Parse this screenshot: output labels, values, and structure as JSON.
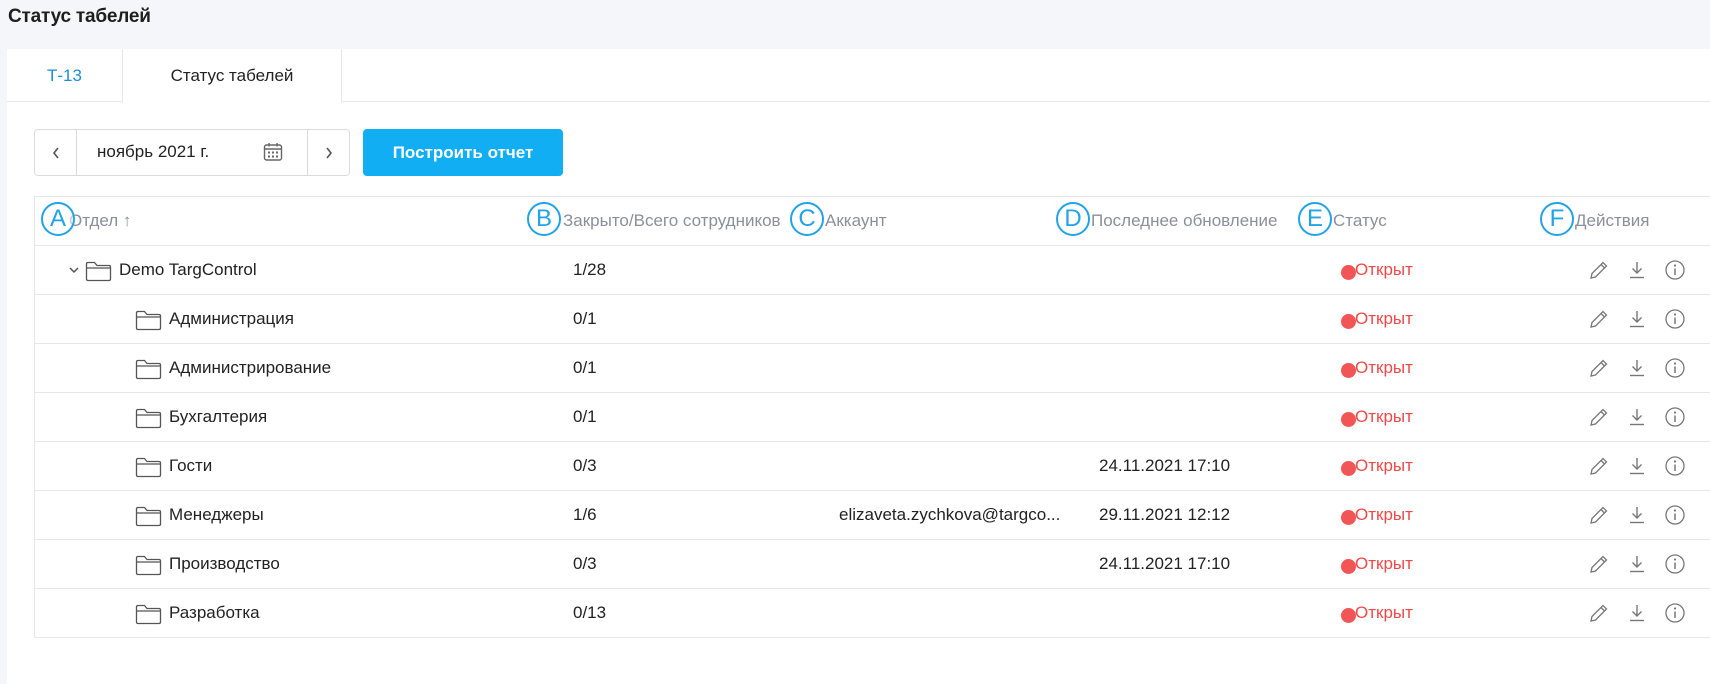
{
  "page": {
    "title": "Статус табелей"
  },
  "tabs": [
    {
      "label": "Т-13"
    },
    {
      "label": "Статус табелей"
    }
  ],
  "toolbar": {
    "date_value": "ноябрь 2021 г.",
    "prev_icon": "chevron-left-icon",
    "next_icon": "chevron-right-icon",
    "calendar_icon": "calendar-icon",
    "build_label": "Построить отчет"
  },
  "table": {
    "columns": {
      "otdel": "Отдел ↑",
      "zakr": "Закрыто/Всего сотрудников",
      "acc": "Аккаунт",
      "upd": "Последнее обновление",
      "status": "Статус",
      "act": "Действия"
    },
    "markers": [
      "A",
      "B",
      "C",
      "D",
      "E",
      "F"
    ],
    "rows": [
      {
        "name": "Demo TargControl",
        "count": "1/28",
        "account": "",
        "updated": "",
        "status": "Открыт"
      },
      {
        "name": "Администрация",
        "count": "0/1",
        "account": "",
        "updated": "",
        "status": "Открыт"
      },
      {
        "name": "Администрирование",
        "count": "0/1",
        "account": "",
        "updated": "",
        "status": "Открыт"
      },
      {
        "name": "Бухгалтерия",
        "count": "0/1",
        "account": "",
        "updated": "",
        "status": "Открыт"
      },
      {
        "name": "Гости",
        "count": "0/3",
        "account": "",
        "updated": "24.11.2021 17:10",
        "status": "Открыт"
      },
      {
        "name": "Менеджеры",
        "count": "1/6",
        "account": "elizaveta.zychkova@targco...",
        "updated": "29.11.2021 12:12",
        "status": "Открыт"
      },
      {
        "name": "Производство",
        "count": "0/3",
        "account": "",
        "updated": "24.11.2021 17:10",
        "status": "Открыт"
      },
      {
        "name": "Разработка",
        "count": "0/13",
        "account": "",
        "updated": "",
        "status": "Открыт"
      }
    ]
  },
  "colors": {
    "accent": "#12aef4",
    "status_open": "#f25555",
    "tab_link": "#1a8fd6"
  }
}
